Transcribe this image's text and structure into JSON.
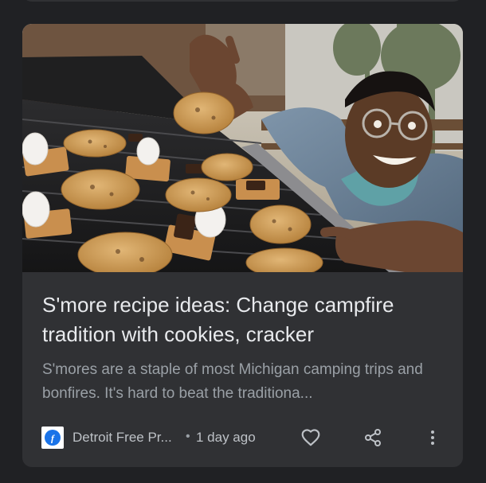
{
  "article": {
    "title": "S'more recipe ideas: Change campfire tradition with cookies, cracker",
    "snippet": "S'mores are a staple of most Michigan camping trips and bonfires. It's hard to beat the traditiona...",
    "publisher": "Detroit Free Pr...",
    "separator": "•",
    "time": "1 day ago"
  },
  "icons": {
    "publisher_logo": "detroit-free-press-logo",
    "like": "heart-outline-icon",
    "share": "share-icon",
    "more": "more-vert-icon"
  },
  "colors": {
    "background": "#202124",
    "card": "#303134",
    "title": "#e8eaed",
    "snippet": "#9aa0a6",
    "icon": "#bdc1c6",
    "logo_blue": "#1a73e8"
  }
}
